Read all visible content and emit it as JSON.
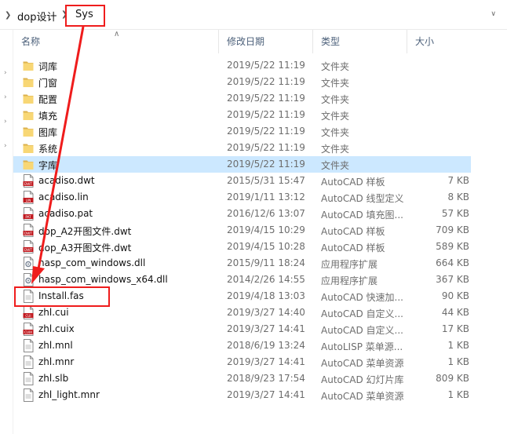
{
  "nav": {
    "breadcrumb": [
      {
        "label": "dop设计"
      },
      {
        "label": "Sys"
      }
    ]
  },
  "columns": {
    "name": "名称",
    "date": "修改日期",
    "type": "类型",
    "size": "大小"
  },
  "files": [
    {
      "name": "词库",
      "date": "2019/5/22 11:19",
      "type": "文件夹",
      "size": "",
      "icon": "folder-icon"
    },
    {
      "name": "门窗",
      "date": "2019/5/22 11:19",
      "type": "文件夹",
      "size": "",
      "icon": "folder-icon"
    },
    {
      "name": "配置",
      "date": "2019/5/22 11:19",
      "type": "文件夹",
      "size": "",
      "icon": "folder-icon"
    },
    {
      "name": "填充",
      "date": "2019/5/22 11:19",
      "type": "文件夹",
      "size": "",
      "icon": "folder-icon"
    },
    {
      "name": "图库",
      "date": "2019/5/22 11:19",
      "type": "文件夹",
      "size": "",
      "icon": "folder-icon"
    },
    {
      "name": "系统",
      "date": "2019/5/22 11:19",
      "type": "文件夹",
      "size": "",
      "icon": "folder-icon"
    },
    {
      "name": "字库",
      "date": "2019/5/22 11:19",
      "type": "文件夹",
      "size": "",
      "icon": "folder-icon",
      "selected": true
    },
    {
      "name": "acadiso.dwt",
      "date": "2015/5/31 15:47",
      "type": "AutoCAD 样板",
      "size": "7 KB",
      "icon": "dwt-file-icon",
      "badge": "DWT"
    },
    {
      "name": "acadiso.lin",
      "date": "2019/1/11 13:12",
      "type": "AutoCAD 线型定义",
      "size": "8 KB",
      "icon": "lin-file-icon",
      "badge": "LIN"
    },
    {
      "name": "acadiso.pat",
      "date": "2016/12/6 13:07",
      "type": "AutoCAD 填充图...",
      "size": "57 KB",
      "icon": "pat-file-icon",
      "badge": "PAT"
    },
    {
      "name": "dop_A2开图文件.dwt",
      "date": "2019/4/15 10:29",
      "type": "AutoCAD 样板",
      "size": "709 KB",
      "icon": "dwt-file-icon",
      "badge": "DWT"
    },
    {
      "name": "dop_A3开图文件.dwt",
      "date": "2019/4/15 10:28",
      "type": "AutoCAD 样板",
      "size": "589 KB",
      "icon": "dwt-file-icon",
      "badge": "DWT"
    },
    {
      "name": "hasp_com_windows.dll",
      "date": "2015/9/11 18:24",
      "type": "应用程序扩展",
      "size": "664 KB",
      "icon": "dll-file-icon"
    },
    {
      "name": "hasp_com_windows_x64.dll",
      "date": "2014/2/26 14:55",
      "type": "应用程序扩展",
      "size": "367 KB",
      "icon": "dll-file-icon"
    },
    {
      "name": "Install.fas",
      "date": "2019/4/18 13:03",
      "type": "AutoCAD 快速加...",
      "size": "90 KB",
      "icon": "generic-file-icon"
    },
    {
      "name": "zhl.cui",
      "date": "2019/3/27 14:40",
      "type": "AutoCAD 自定义...",
      "size": "44 KB",
      "icon": "cui-file-icon",
      "badge": "CUI"
    },
    {
      "name": "zhl.cuix",
      "date": "2019/3/27 14:41",
      "type": "AutoCAD 自定义...",
      "size": "17 KB",
      "icon": "cuix-file-icon",
      "badge": "CUIX"
    },
    {
      "name": "zhl.mnl",
      "date": "2018/6/19 13:24",
      "type": "AutoLISP 菜单源...",
      "size": "1 KB",
      "icon": "generic-file-icon"
    },
    {
      "name": "zhl.mnr",
      "date": "2019/3/27 14:41",
      "type": "AutoCAD 菜单资源",
      "size": "1 KB",
      "icon": "generic-file-icon"
    },
    {
      "name": "zhl.slb",
      "date": "2018/9/23 17:54",
      "type": "AutoCAD 幻灯片库",
      "size": "809 KB",
      "icon": "generic-file-icon"
    },
    {
      "name": "zhl_light.mnr",
      "date": "2019/3/27 14:41",
      "type": "AutoCAD 菜单资源",
      "size": "1 KB",
      "icon": "generic-file-icon"
    }
  ],
  "colors": {
    "selection": "#cce8ff",
    "annotation": "#ef1c1c",
    "folder": "#f8d775",
    "autocad_badge": "#c0191f"
  }
}
